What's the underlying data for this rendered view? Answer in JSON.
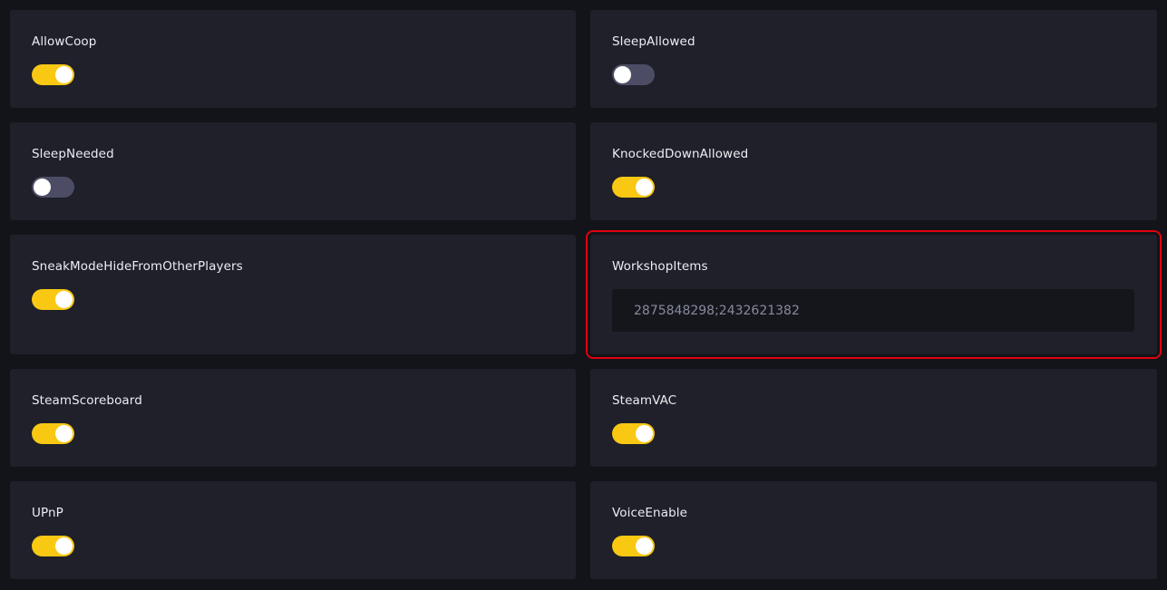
{
  "settings": [
    {
      "label": "AllowCoop",
      "type": "toggle",
      "enabled": true
    },
    {
      "label": "SleepAllowed",
      "type": "toggle",
      "enabled": false
    },
    {
      "label": "SleepNeeded",
      "type": "toggle",
      "enabled": false
    },
    {
      "label": "KnockedDownAllowed",
      "type": "toggle",
      "enabled": true
    },
    {
      "label": "SneakModeHideFromOtherPlayers",
      "type": "toggle",
      "enabled": true
    },
    {
      "label": "WorkshopItems",
      "type": "text",
      "value": "2875848298;2432621382",
      "highlighted": true
    },
    {
      "label": "SteamScoreboard",
      "type": "toggle",
      "enabled": true
    },
    {
      "label": "SteamVAC",
      "type": "toggle",
      "enabled": true
    },
    {
      "label": "UPnP",
      "type": "toggle",
      "enabled": true
    },
    {
      "label": "VoiceEnable",
      "type": "toggle",
      "enabled": true
    }
  ],
  "colors": {
    "toggle_on": "#f8c813",
    "toggle_off": "#4c4d65",
    "highlight": "#e3000f",
    "card_bg": "#1f2029",
    "page_bg": "#131419"
  }
}
